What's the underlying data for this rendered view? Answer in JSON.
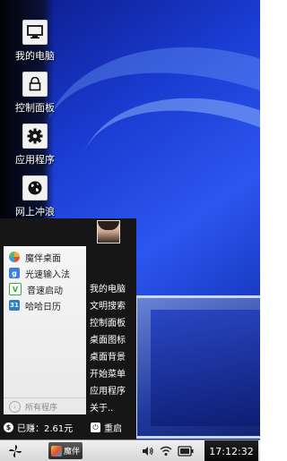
{
  "desktop": {
    "icons": [
      {
        "label": "我的电脑",
        "icon": "monitor-icon"
      },
      {
        "label": "控制面板",
        "icon": "lock-icon"
      },
      {
        "label": "应用程序",
        "icon": "gear-icon"
      },
      {
        "label": "网上冲浪",
        "icon": "globe-icon"
      }
    ]
  },
  "start_menu": {
    "apps": [
      {
        "label": "魔伴桌面",
        "icon": "pinwheel-icon",
        "color": "#f2a93b"
      },
      {
        "label": "光速输入法",
        "icon": "g-letter-icon",
        "glyph": "g",
        "color": "#3b7ee0"
      },
      {
        "label": "音速启动",
        "icon": "v-letter-icon",
        "glyph": "V",
        "color": "#3aa64a"
      },
      {
        "label": "哈哈日历",
        "icon": "calendar-icon",
        "glyph": "31",
        "color": "#2a7fd4"
      }
    ],
    "all_programs": "所有程序",
    "system_items": [
      "我的电脑",
      "文明搜索",
      "控制面板",
      "桌面图标",
      "桌面背景",
      "开始菜单",
      "应用程序",
      "关于.."
    ],
    "earned": "已赚：2.61元",
    "restart": "重启"
  },
  "taskbar": {
    "start_icon": "pinwheel-icon",
    "active_task": "魔伴",
    "clock": "17:12:32"
  }
}
